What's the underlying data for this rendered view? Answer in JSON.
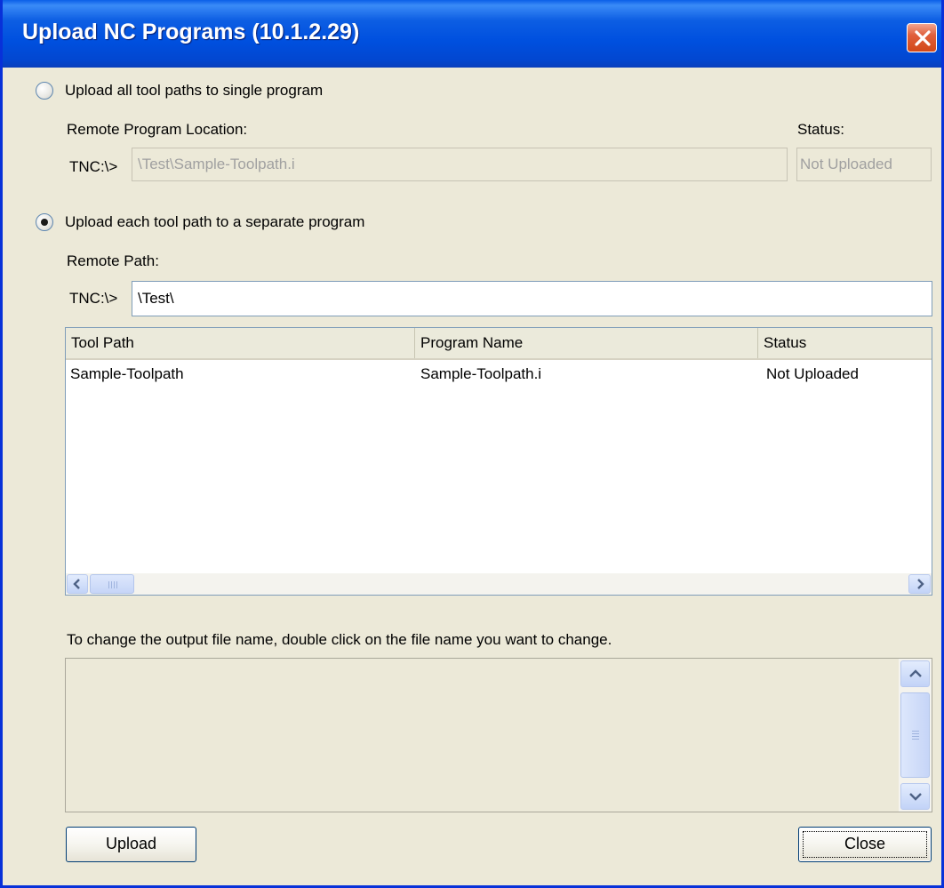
{
  "window": {
    "title": "Upload NC Programs (10.1.2.29)"
  },
  "single_program": {
    "radio_label": "Upload all tool paths to single program",
    "selected": false,
    "location_label": "Remote Program Location:",
    "drive_prefix": "TNC:\\>",
    "path_value": "\\Test\\Sample-Toolpath.i",
    "status_label": "Status:",
    "status_value": "Not Uploaded"
  },
  "separate_programs": {
    "radio_label": "Upload each tool path to a separate program",
    "selected": true,
    "path_label": "Remote Path:",
    "drive_prefix": "TNC:\\>",
    "path_value": "\\Test\\"
  },
  "toolpath_table": {
    "columns": [
      "Tool Path",
      "Program Name",
      "Status"
    ],
    "rows": [
      [
        "Sample-Toolpath",
        "Sample-Toolpath.i",
        "Not Uploaded"
      ]
    ]
  },
  "hint_text": "To change the output file name, double click on the file name you want to change.",
  "buttons": {
    "upload": "Upload",
    "close": "Close"
  },
  "icons": {
    "close": "close-x-icon",
    "scroll_left": "arrow-left-icon",
    "scroll_right": "arrow-right-icon",
    "scroll_up": "arrow-up-icon",
    "scroll_down": "arrow-down-icon"
  },
  "colors": {
    "titlebar": "#0050df",
    "dialog_bg": "#ece9d8",
    "close_button": "#d24818"
  }
}
